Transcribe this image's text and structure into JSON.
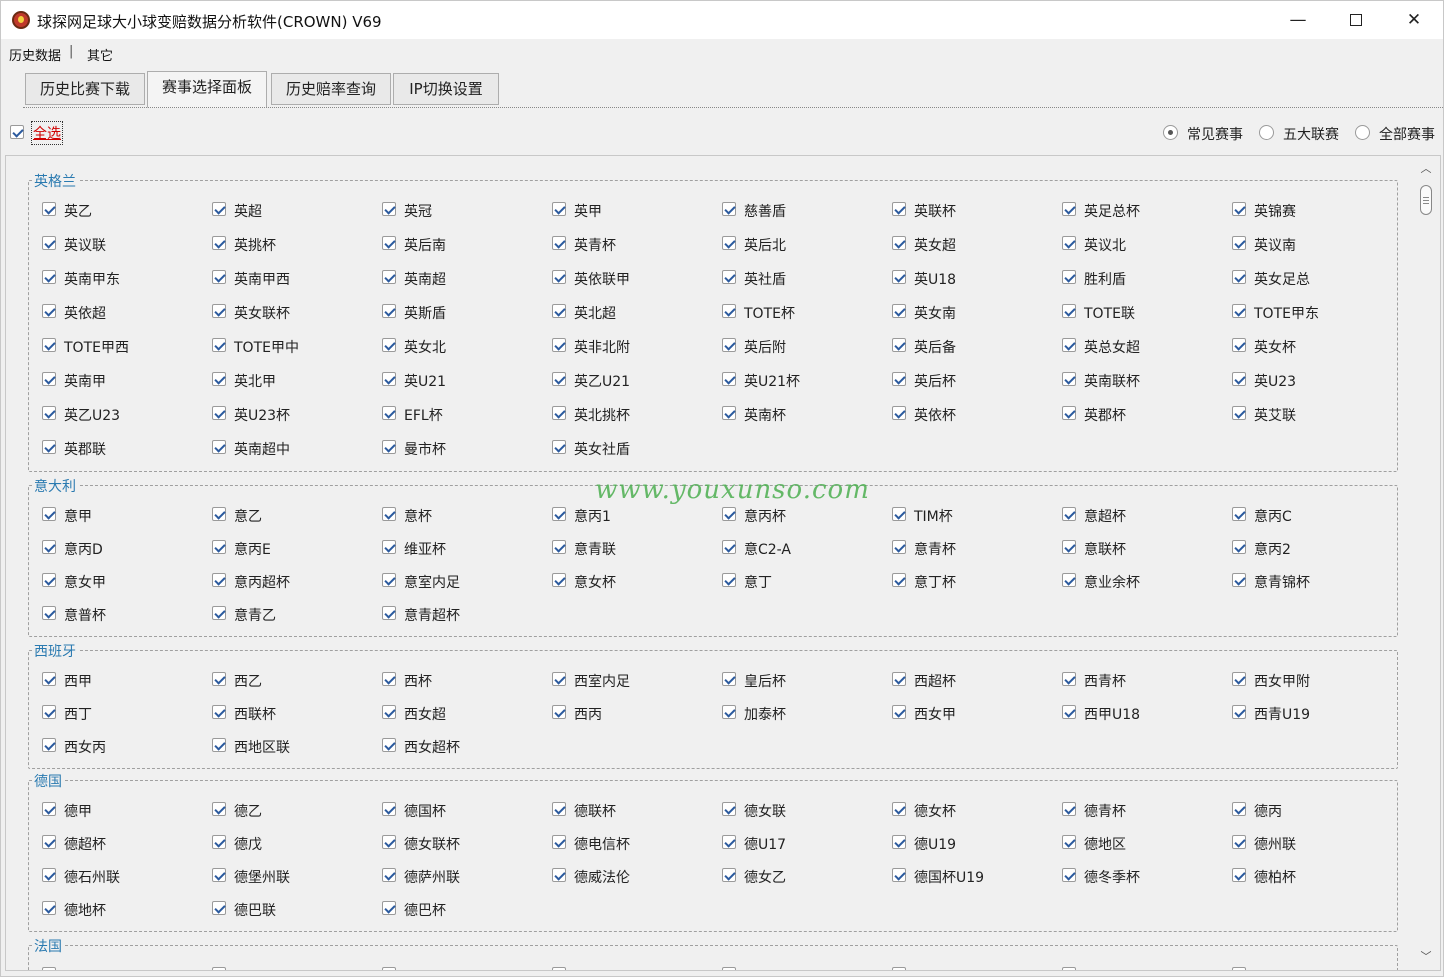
{
  "window": {
    "title": "球探网足球大小球变赔数据分析软件(CROWN) V69",
    "min_glyph": "—",
    "close_glyph": "✕"
  },
  "menu": {
    "items": [
      "历史数据",
      "其它"
    ],
    "separator": "|"
  },
  "tabs": [
    {
      "label": "历史比赛下载"
    },
    {
      "label": "赛事选择面板",
      "active": true
    },
    {
      "label": "历史赔率查询"
    },
    {
      "label": "IP切换设置"
    }
  ],
  "selectall": {
    "label": "全选",
    "checked": true
  },
  "filters": [
    {
      "label": "常见赛事",
      "selected": true
    },
    {
      "label": "五大联赛",
      "selected": false
    },
    {
      "label": "全部赛事",
      "selected": false
    }
  ],
  "watermark": "www.youxunso.com",
  "groups": [
    {
      "title": "英格兰",
      "items": [
        "英乙",
        "英超",
        "英冠",
        "英甲",
        "慈善盾",
        "英联杯",
        "英足总杯",
        "英锦赛",
        "英议联",
        "英挑杯",
        "英后南",
        "英青杯",
        "英后北",
        "英女超",
        "英议北",
        "英议南",
        "英南甲东",
        "英南甲西",
        "英南超",
        "英依联甲",
        "英社盾",
        "英U18",
        "胜利盾",
        "英女足总",
        "英依超",
        "英女联杯",
        "英斯盾",
        "英北超",
        "TOTE杯",
        "英女南",
        "TOTE联",
        "TOTE甲东",
        "TOTE甲西",
        "TOTE甲中",
        "英女北",
        "英非北附",
        "英后附",
        "英后备",
        "英总女超",
        "英女杯",
        "英南甲",
        "英北甲",
        "英U21",
        "英乙U21",
        "英U21杯",
        "英后杯",
        "英南联杯",
        "英U23",
        "英乙U23",
        "英U23杯",
        "EFL杯",
        "英北挑杯",
        "英南杯",
        "英依杯",
        "英郡杯",
        "英艾联",
        "英郡联",
        "英南超中",
        "曼市杯",
        "英女社盾"
      ]
    },
    {
      "title": "意大利",
      "items": [
        "意甲",
        "意乙",
        "意杯",
        "意丙1",
        "意丙杯",
        "TIM杯",
        "意超杯",
        "意丙C",
        "意丙D",
        "意丙E",
        "维亚杯",
        "意青联",
        "意C2-A",
        "意青杯",
        "意联杯",
        "意丙2",
        "意女甲",
        "意丙超杯",
        "意室内足",
        "意女杯",
        "意丁",
        "意丁杯",
        "意业余杯",
        "意青锦杯",
        "意普杯",
        "意青乙",
        "意青超杯"
      ]
    },
    {
      "title": "西班牙",
      "items": [
        "西甲",
        "西乙",
        "西杯",
        "西室内足",
        "皇后杯",
        "西超杯",
        "西青杯",
        "西女甲附",
        "西丁",
        "西联杯",
        "西女超",
        "西丙",
        "加泰杯",
        "西女甲",
        "西甲U18",
        "西青U19",
        "西女丙",
        "西地区联",
        "西女超杯"
      ]
    },
    {
      "title": "德国",
      "items": [
        "德甲",
        "德乙",
        "德国杯",
        "德联杯",
        "德女联",
        "德女杯",
        "德青杯",
        "德丙",
        "德超杯",
        "德戊",
        "德女联杯",
        "德电信杯",
        "德U17",
        "德U19",
        "德地区",
        "德州联",
        "德石州联",
        "德堡州联",
        "德萨州联",
        "德威法伦",
        "德女乙",
        "德国杯U19",
        "德冬季杯",
        "德柏杯",
        "德地杯",
        "德巴联",
        "德巴杯"
      ]
    },
    {
      "title": "法国",
      "items": []
    }
  ]
}
